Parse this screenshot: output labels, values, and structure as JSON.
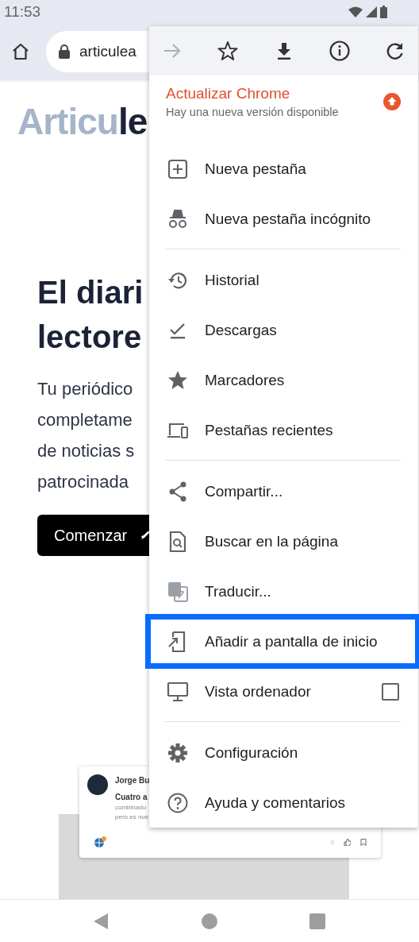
{
  "status_bar": {
    "time": "11:53"
  },
  "address_bar": {
    "url": "articulea"
  },
  "page": {
    "logo": {
      "light": "Articu",
      "dark": "le"
    },
    "heading": [
      "El diari",
      "lectore"
    ],
    "paragraph": [
      "Tu periódico",
      "completame",
      "de noticias s",
      "patrocinada"
    ],
    "button": "Comenzar",
    "card": {
      "author": "Jorge Bu",
      "title": "Cuatro a",
      "excerpt": [
        "combinado",
        "pero es nue"
      ],
      "likes": "0"
    }
  },
  "menu": {
    "toolbar": [
      {
        "kind": "forward",
        "disabled": true
      },
      {
        "kind": "star",
        "disabled": false
      },
      {
        "kind": "download",
        "disabled": false
      },
      {
        "kind": "info",
        "disabled": false
      },
      {
        "kind": "reload",
        "disabled": false
      }
    ],
    "update": {
      "title": "Actualizar Chrome",
      "subtitle": "Hay una nueva versión disponible"
    },
    "groups": [
      [
        {
          "label": "Nueva pestaña",
          "highlighted": false
        },
        {
          "label": "Nueva pestaña incógnito",
          "highlighted": false
        }
      ],
      [
        {
          "label": "Historial",
          "highlighted": false
        },
        {
          "label": "Descargas",
          "highlighted": false
        },
        {
          "label": "Marcadores",
          "highlighted": false
        },
        {
          "label": "Pestañas recientes",
          "highlighted": false
        }
      ],
      [
        {
          "label": "Compartir...",
          "highlighted": false
        },
        {
          "label": "Buscar en la página",
          "highlighted": false
        },
        {
          "label": "Traducir...",
          "highlighted": false
        },
        {
          "label": "Añadir a pantalla de inicio",
          "highlighted": true
        },
        {
          "label": "Vista ordenador",
          "highlighted": false,
          "kind": "checkbox",
          "checked": false
        }
      ],
      [
        {
          "label": "Configuración",
          "highlighted": false
        },
        {
          "label": "Ayuda y comentarios",
          "highlighted": false
        }
      ]
    ]
  }
}
